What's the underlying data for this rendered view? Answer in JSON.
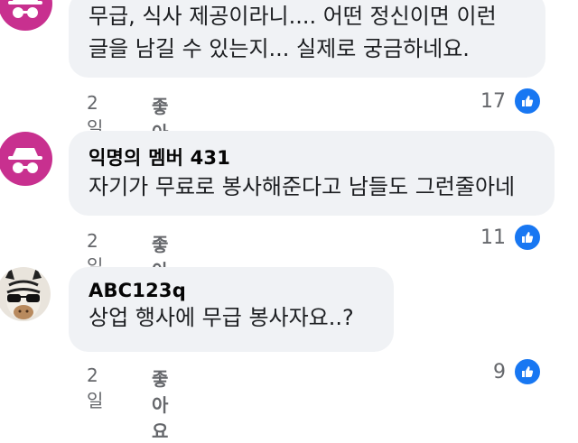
{
  "comments": [
    {
      "avatar": "anonymous-avatar",
      "text_lines": [
        "무급, 식사 제공이라니.... 어떤 정신이면 이런",
        "글을 남길 수 있는지... 실제로 궁금하네요."
      ],
      "time": "2일",
      "like_label": "좋아요",
      "likes": "17"
    },
    {
      "avatar": "anonymous-avatar",
      "author": "익명의 멤버 431",
      "text_lines": [
        "자기가 무료로 봉사해준다고 남들도 그런줄아네"
      ],
      "time": "2일",
      "like_label": "좋아요",
      "likes": "11"
    },
    {
      "avatar": "zebra-sunglasses-avatar",
      "author": "ABC123q",
      "text_lines": [
        "상업 행사에 무급 봉사자요..?"
      ],
      "time": "2일",
      "like_label": "좋아요",
      "likes": "9"
    }
  ],
  "colors": {
    "anon_avatar": "#c8308f",
    "like_blue": "#1877f2",
    "bubble_bg": "#f0f2f5",
    "meta_gray": "#65676b"
  }
}
